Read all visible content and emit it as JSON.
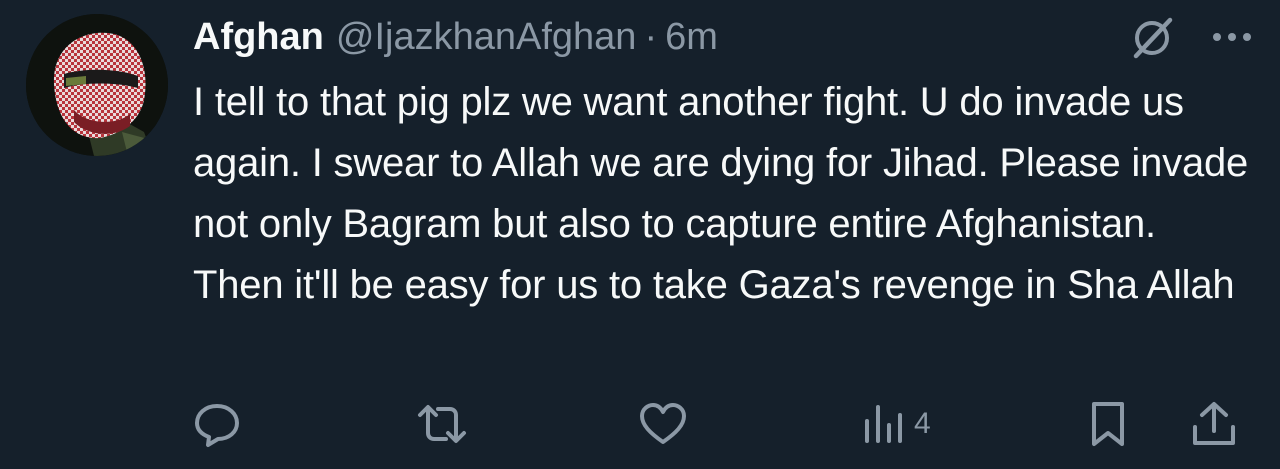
{
  "tweet": {
    "display_name": "Afghan",
    "handle": "@IjazkhanAfghan",
    "separator": "·",
    "time": "6m",
    "text": "I tell to that pig plz we want another fight. U do invade us again. I swear to Allah we are dying for Jihad. Please invade not only Bagram but also to capture entire Afghanistan. Then it'll be easy for us to take Gaza's revenge in Sha Allah",
    "avatar_icon": "avatar-keffiyeh",
    "top_icons": [
      "grok-icon",
      "more-icon"
    ]
  },
  "actions": {
    "reply": {
      "icon": "reply-icon"
    },
    "retweet": {
      "icon": "retweet-icon"
    },
    "like": {
      "icon": "like-icon"
    },
    "views": {
      "icon": "views-icon",
      "count": "4"
    },
    "bookmark": {
      "icon": "bookmark-icon"
    },
    "share": {
      "icon": "share-icon"
    }
  },
  "colors": {
    "background": "#15202b",
    "primary_text": "#f7f9f9",
    "secondary_text": "#8b98a5"
  }
}
